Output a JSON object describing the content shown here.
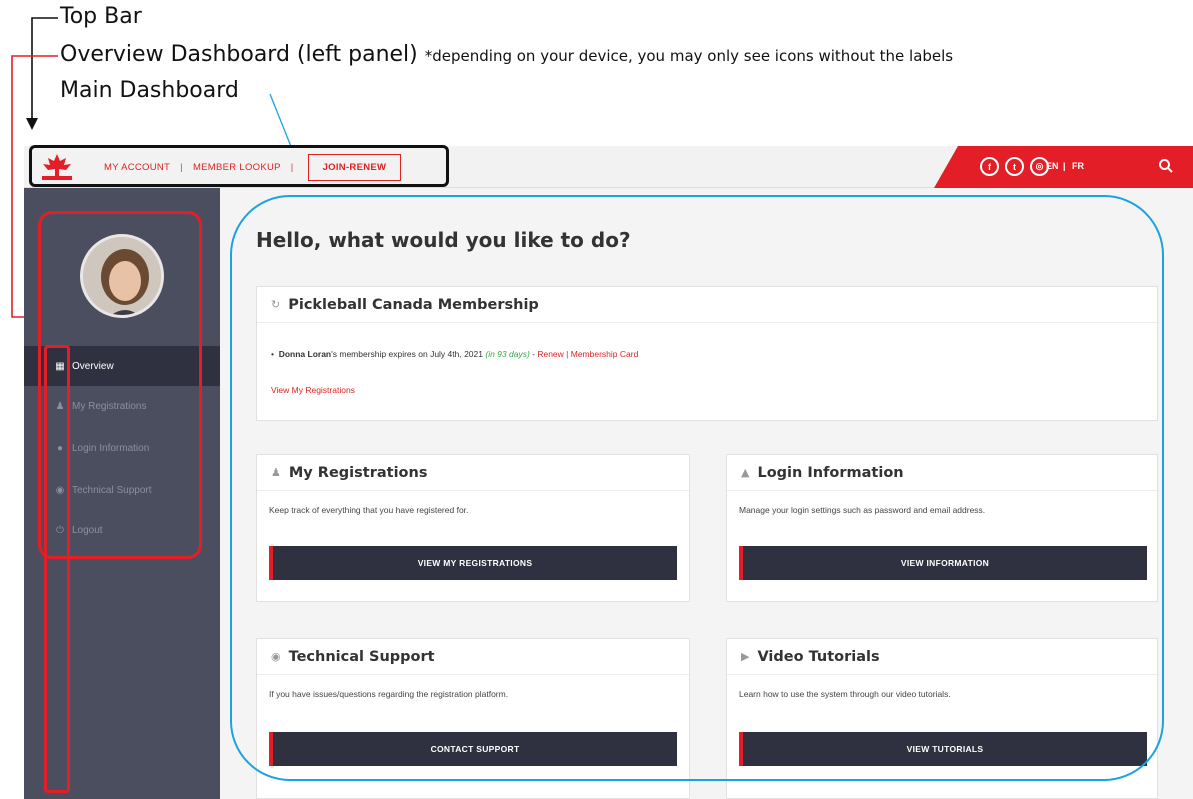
{
  "annotations": {
    "top_bar": "Top Bar",
    "overview_dashboard": "Overview Dashboard (left panel)",
    "overview_note": "*depending on your device, you may only see icons without the labels",
    "main_dashboard": "Main Dashboard"
  },
  "topbar": {
    "nav": [
      "MY ACCOUNT",
      "MEMBER LOOKUP",
      "JOIN-RENEW"
    ],
    "separator": "|",
    "lang_en": "EN",
    "lang_sep": "|",
    "lang_fr": "FR",
    "social_icons": [
      "facebook-icon",
      "twitter-icon",
      "instagram-icon"
    ]
  },
  "sidebar": {
    "items": [
      {
        "label": "Overview",
        "icon": "grid-icon",
        "active": true
      },
      {
        "label": "My Registrations",
        "icon": "user-icon",
        "active": false
      },
      {
        "label": "Login Information",
        "icon": "lock-icon",
        "active": false
      },
      {
        "label": "Technical Support",
        "icon": "support-icon",
        "active": false
      },
      {
        "label": "Logout",
        "icon": "power-icon",
        "active": false
      }
    ]
  },
  "main": {
    "greeting": "Hello, what would you like to do?",
    "membership": {
      "title": "Pickleball Canada Membership",
      "member_name": "Donna Loran",
      "expiry_text": "'s membership expires on July 4th, 2021 ",
      "days_left": "(in 93 days)",
      "dash": " - ",
      "renew": "Renew",
      "pipe": " | ",
      "card": "Membership Card",
      "view_link": "View My Registrations"
    },
    "cards": {
      "registrations": {
        "title": "My Registrations",
        "desc": "Keep track of everything that you have registered for.",
        "button": "VIEW MY REGISTRATIONS"
      },
      "login": {
        "title": "Login Information",
        "desc": "Manage your login settings such as password and email address.",
        "button": "VIEW INFORMATION"
      },
      "support": {
        "title": "Technical Support",
        "desc": "If you have issues/questions regarding the registration platform.",
        "button": "CONTACT SUPPORT"
      },
      "tutorials": {
        "title": "Video Tutorials",
        "desc": "Learn how to use the system through our video tutorials.",
        "button": "VIEW TUTORIALS"
      }
    }
  },
  "colors": {
    "brand_red": "#e41e26",
    "sidebar_bg": "#4b4e5e",
    "button_dark": "#2f3140",
    "highlight_blue": "#1aa3e0"
  }
}
